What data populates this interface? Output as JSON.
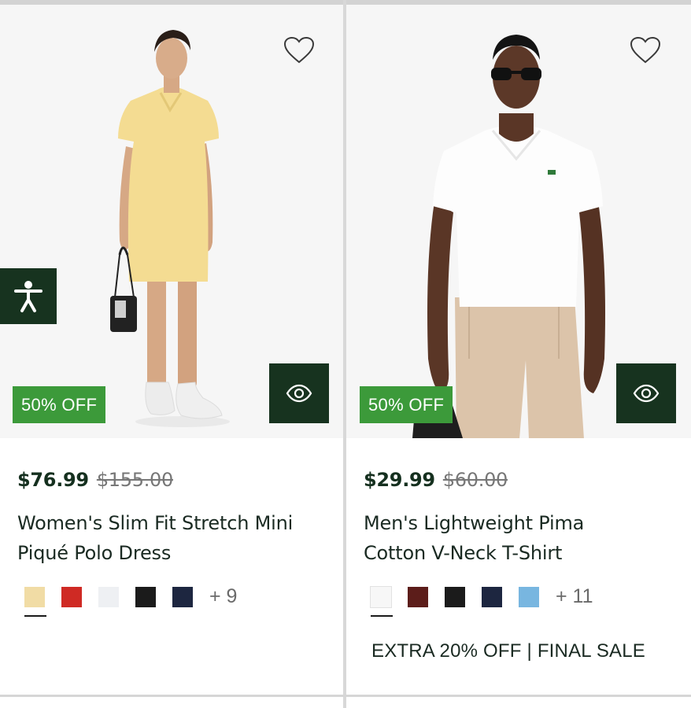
{
  "products": [
    {
      "badge": "50% OFF",
      "price_now": "$76.99",
      "price_was": "$155.00",
      "title_line1": "Women's Slim Fit Stretch Mini",
      "title_line2": "Piqué Polo Dress",
      "swatches": [
        "#f1dca5",
        "#cf2a24",
        "#eef0f3",
        "#1b1b1b",
        "#1d2640"
      ],
      "more_colors": "+ 9",
      "icons": {
        "wishlist": "heart-outline-icon",
        "quick_view": "eye-icon"
      }
    },
    {
      "badge": "50% OFF",
      "price_now": "$29.99",
      "price_was": "$60.00",
      "title_line1": "Men's Lightweight Pima",
      "title_line2": "Cotton V-Neck T-Shirt",
      "swatches": [
        "#f7f7f7",
        "#5c1d1a",
        "#1b1b1b",
        "#1d2640",
        "#78b6e0"
      ],
      "more_colors": "+ 11",
      "promo": "EXTRA 20% OFF | FINAL SALE",
      "icons": {
        "wishlist": "heart-outline-icon",
        "quick_view": "eye-icon"
      }
    }
  ],
  "accessibility": {
    "icon": "accessibility-person-icon"
  },
  "colors": {
    "brand_dark_green": "#17331f",
    "badge_green": "#3c9a3a",
    "image_bg": "#f6f6f6"
  }
}
